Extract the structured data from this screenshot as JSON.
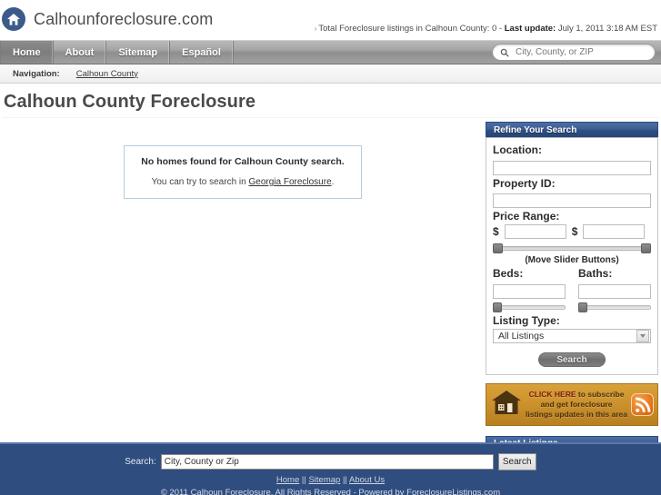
{
  "header": {
    "logo_icon": "house-in-circle-icon",
    "site_title": "Calhounforeclosure.com",
    "stats_bullet": "›",
    "stats_prefix": "Total Foreclosure listings in Calhoun County: 0 - ",
    "stats_label": "Last update:",
    "stats_value": " July 1, 2011 3:18 AM EST"
  },
  "nav": {
    "items": [
      {
        "label": "Home"
      },
      {
        "label": "About"
      },
      {
        "label": "Sitemap"
      },
      {
        "label": "Español"
      }
    ],
    "search": {
      "icon": "search-icon",
      "placeholder": "City, County, or ZIP",
      "value": ""
    }
  },
  "breadcrumb": {
    "label": "Navigation:",
    "link": "Calhoun County"
  },
  "page": {
    "title": "Calhoun County Foreclosure"
  },
  "results": {
    "heading": "No homes found for Calhoun County search.",
    "sub_prefix": "You can try to search in ",
    "sub_link": "Georgia Foreclosure",
    "sub_suffix": "."
  },
  "refine": {
    "title": "Refine Your Search",
    "location_label": "Location:",
    "location_value": "",
    "property_id_label": "Property ID:",
    "property_id_value": "",
    "price_range_label": "Price Range:",
    "price_min_prefix": "$",
    "price_min_value": "",
    "price_max_prefix": "$",
    "price_max_value": "",
    "slider_note": "(Move Slider Buttons)",
    "beds_label": "Beds:",
    "beds_value": "",
    "baths_label": "Baths:",
    "baths_value": "",
    "listing_type_label": "Listing Type:",
    "listing_type_selected": "All Listings",
    "listing_type_options": [
      "All Listings"
    ],
    "search_button": "Search"
  },
  "subscribe": {
    "icon": "house-icon",
    "line1": "CLICK HERE",
    "line1_rest": " to subscribe",
    "line2": "and get foreclosure",
    "line3": "listings updates in this area",
    "rss_icon": "rss-icon"
  },
  "latest": {
    "title": "Latest Listings",
    "items": []
  },
  "footer": {
    "search_label": "Search:",
    "search_value": "City, County or Zip",
    "search_placeholder": "City, County or Zip",
    "search_button": "Search",
    "links": [
      {
        "label": "Home"
      },
      {
        "label": "Sitemap"
      },
      {
        "label": "About Us"
      }
    ],
    "link_separator": " || ",
    "copyright_prefix": "© 2011 ",
    "copyright_link": "Calhoun Foreclosure",
    "copyright_suffix": ", All Rights Reserved - Powered by ForeclosureListings.com"
  },
  "colors": {
    "brand_blue": "#2f4d7e",
    "panel_header_blue": "#3b5c92",
    "subscribe_orange": "#c98f2b",
    "rss_orange": "#e2711a",
    "nav_gray": "#9a9a9a"
  }
}
